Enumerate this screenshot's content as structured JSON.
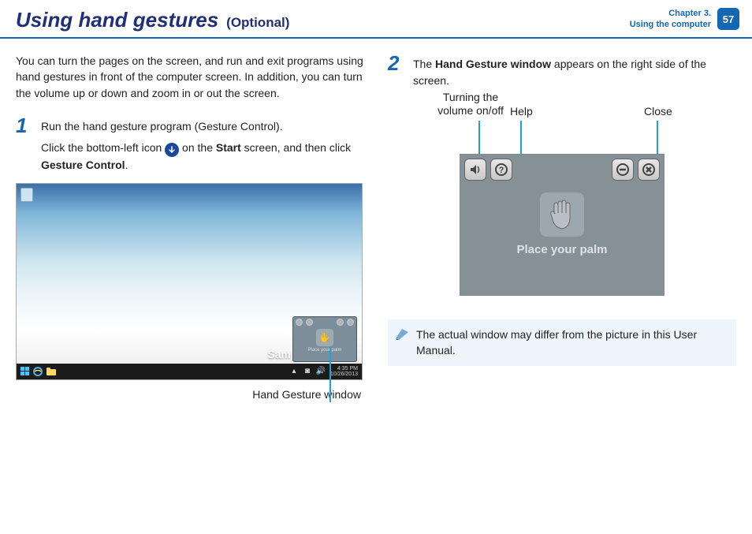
{
  "header": {
    "title": "Using hand gestures",
    "subtitle": "(Optional)",
    "chapter_line1": "Chapter 3.",
    "chapter_line2": "Using the computer",
    "page_number": "57"
  },
  "intro": "You can turn the pages on the screen, and run and exit programs using hand gestures in front of the computer screen. In addition, you can turn the volume up or down and zoom in or out the screen.",
  "step1": {
    "num": "1",
    "line1": "Run the hand gesture program (Gesture Control).",
    "line2a": "Click the bottom-left icon ",
    "line2b": " on the ",
    "start": "Start",
    "line2c": " screen, and then click ",
    "gc": "Gesture Control",
    "line2d": "."
  },
  "desktop": {
    "brand": "Sam",
    "mini_text": "Place your palm",
    "caption": "Hand Gesture window"
  },
  "step2": {
    "num": "2",
    "pre": "The ",
    "bold": "Hand Gesture window",
    "post": " appears on the right side of the screen."
  },
  "annotations": {
    "volume": "Turning the\nvolume on/off",
    "help": "Help",
    "close": "Close"
  },
  "big_window": {
    "palm_text": "Place your palm"
  },
  "note": "The actual window may differ from the picture in this User Manual."
}
